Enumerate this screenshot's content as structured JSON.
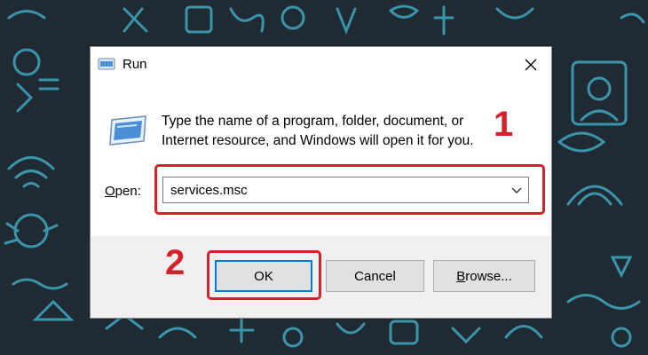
{
  "window": {
    "title": "Run",
    "description": "Type the name of a program, folder, document, or Internet resource, and Windows will open it for you.",
    "open_label_underlined": "O",
    "open_label_rest": "pen:",
    "open_value": "services.msc"
  },
  "buttons": {
    "ok": "OK",
    "cancel": "Cancel",
    "browse_underlined": "B",
    "browse_rest": "rowse..."
  },
  "annotations": {
    "step1": "1",
    "step2": "2"
  },
  "colors": {
    "highlight": "#d6202a",
    "ok_focus": "#0078d7",
    "background": "#1f2a33",
    "doodle": "#3fa7c0"
  },
  "icons": [
    "run-icon",
    "close-icon",
    "dropdown-arrow-icon"
  ]
}
